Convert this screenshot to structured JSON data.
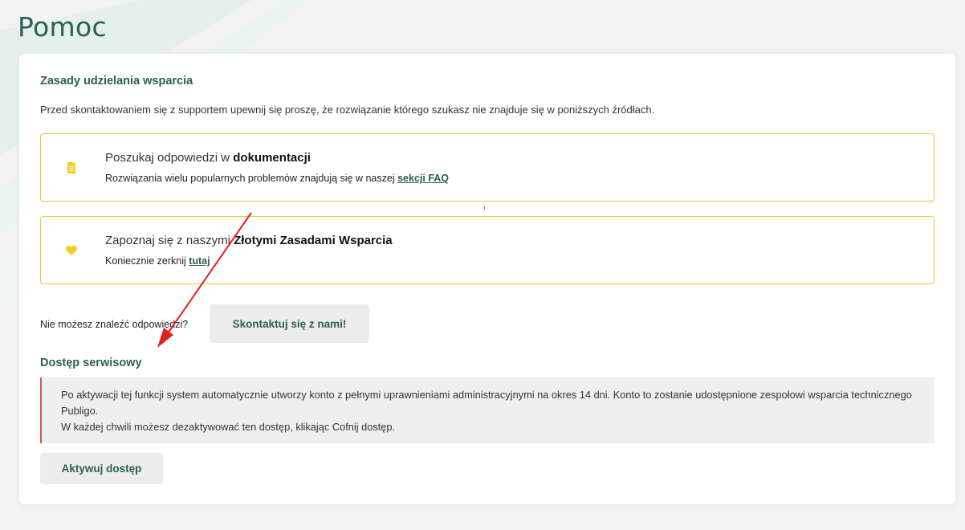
{
  "page": {
    "title": "Pomoc"
  },
  "support_rules": {
    "heading": "Zasady udzielania wsparcia",
    "intro": "Przed skontaktowaniem się z supportem upewnij się proszę, że rozwiązanie którego szukasz nie znajduje się w poniższych źródłach."
  },
  "docs_box": {
    "line1_prefix": "Poszukaj odpowiedzi w ",
    "line1_bold": "dokumentacji",
    "line2_prefix": "Rozwiązania wielu popularnych problemów znajdują się w naszej ",
    "line2_link": "sekcji FAQ"
  },
  "golden_box": {
    "line1_prefix": "Zapoznaj się z naszymi ",
    "line1_bold": "Złotymi Zasadami Wsparcia",
    "line2_prefix": "Koniecznie zerknij ",
    "line2_link": "tutaj"
  },
  "contact": {
    "question": "Nie możesz znaleźć odpowiedzi?",
    "button": "Skontaktuj się z nami!"
  },
  "service_access": {
    "heading": "Dostęp serwisowy",
    "notice_line1": "Po aktywacji tej funkcji system automatycznie utworzy konto z pełnymi uprawnieniami administracyjnymi na okres 14 dni. Konto to zostanie udostępnione zespołowi wsparcia technicznego Publigo.",
    "notice_line2": "W każdej chwili możesz dezaktywować ten dostęp, klikając Cofnij dostęp.",
    "button": "Aktywuj dostęp"
  },
  "colors": {
    "accent": "#2b5f57",
    "box_border": "#e6c92e",
    "icon": "#f2cf1d",
    "notice_border": "#d9534f",
    "annotation_arrow": "#e02020"
  }
}
